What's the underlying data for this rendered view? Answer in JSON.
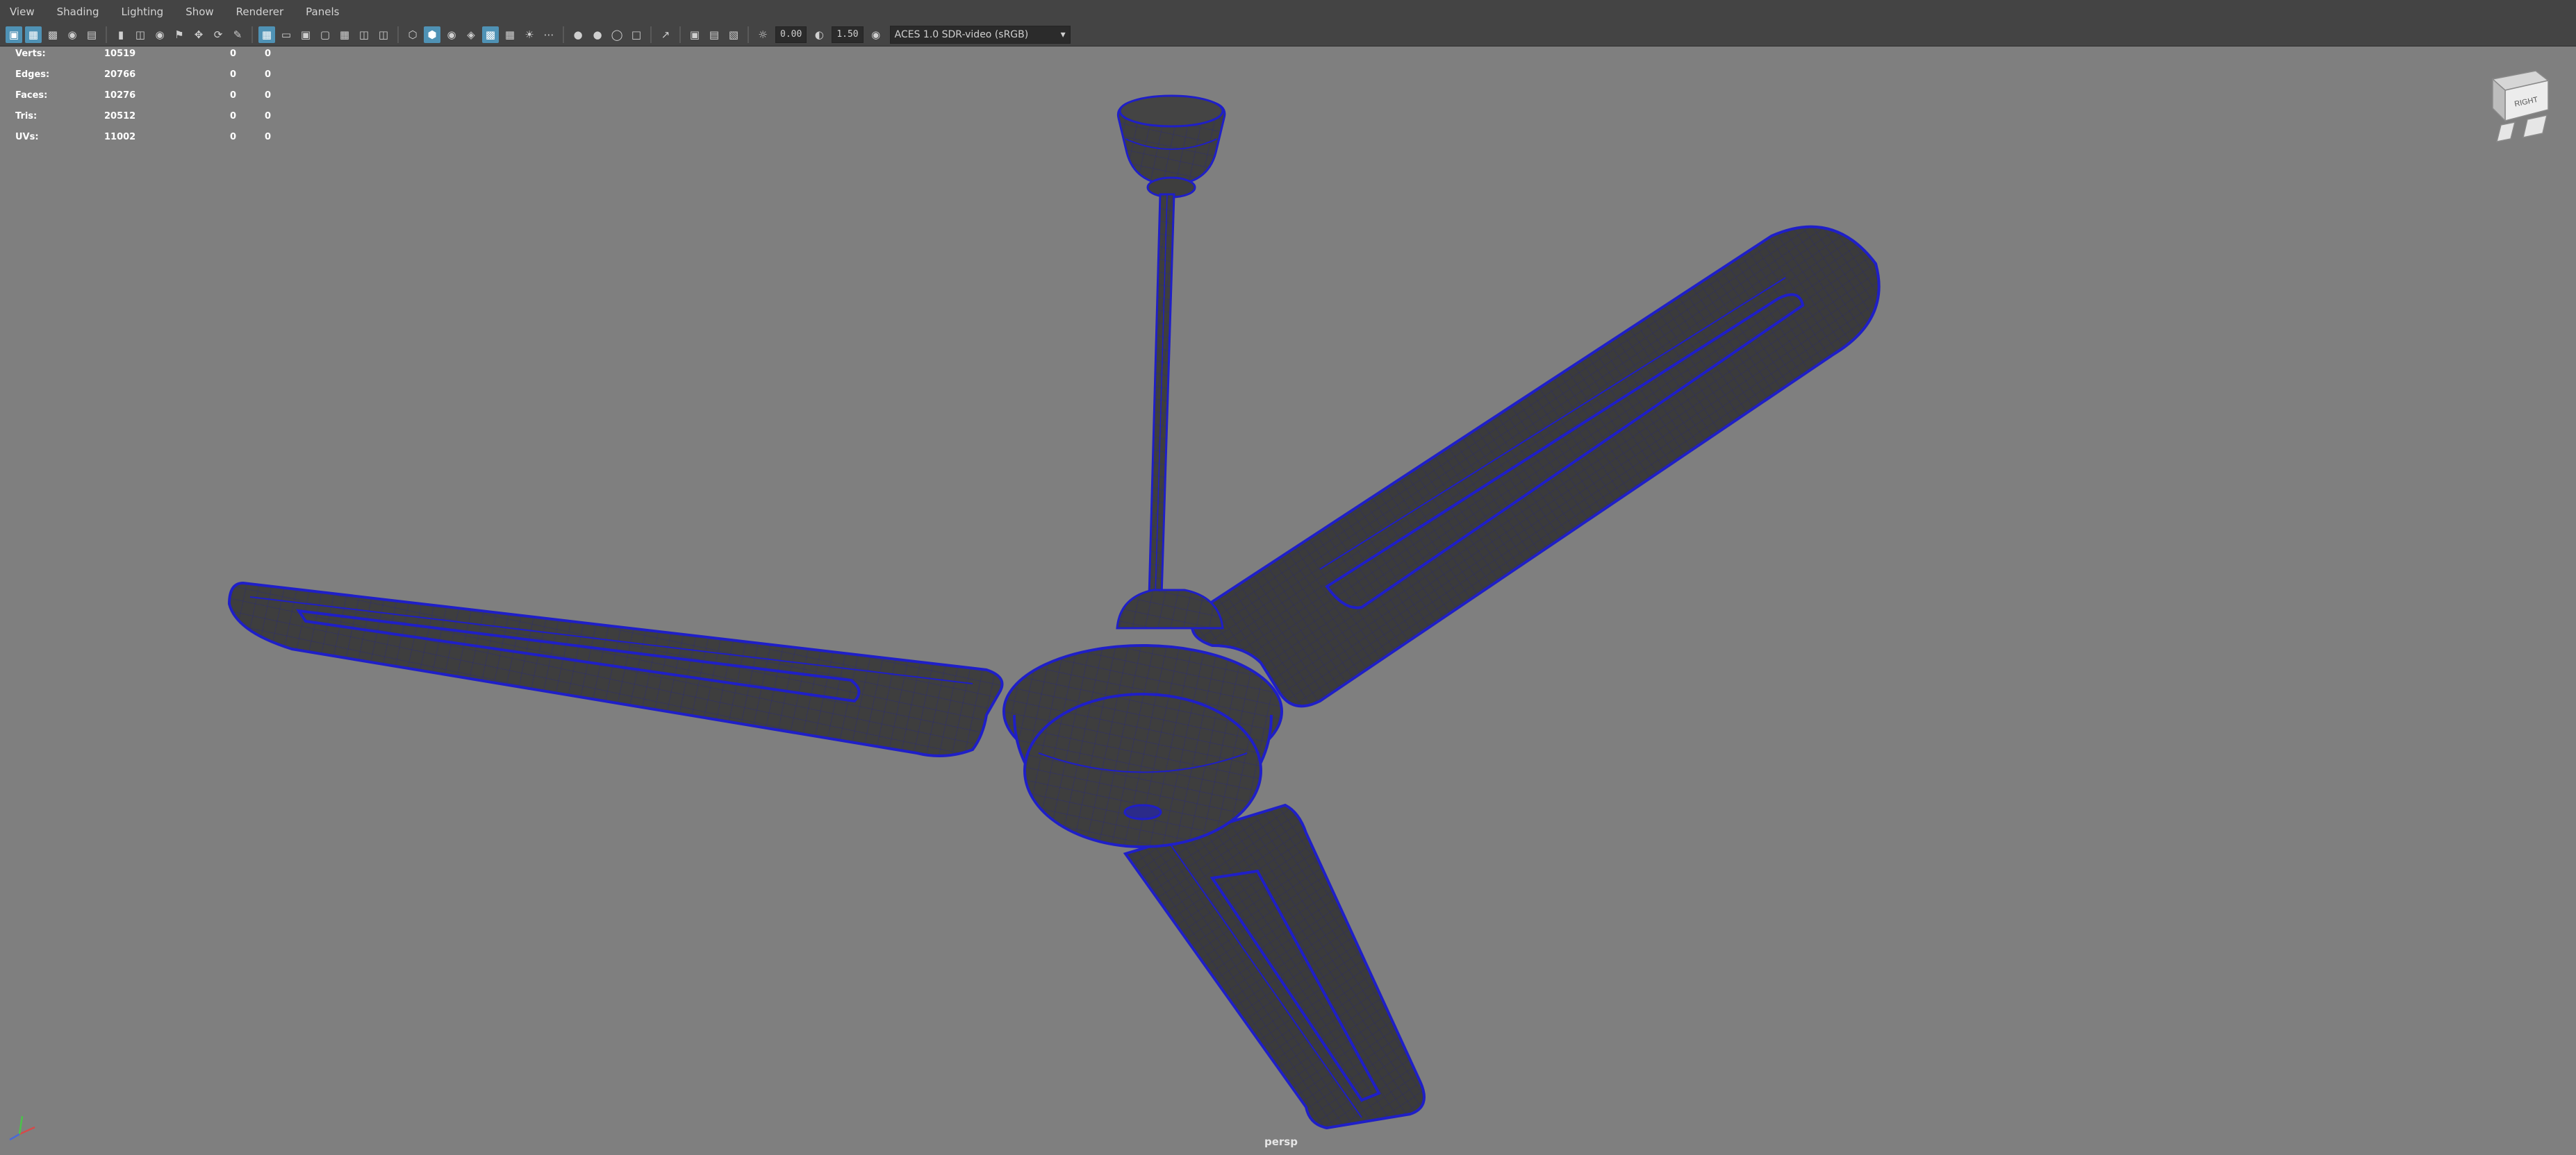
{
  "menubar": {
    "items": [
      {
        "label": "View"
      },
      {
        "label": "Shading"
      },
      {
        "label": "Lighting"
      },
      {
        "label": "Show"
      },
      {
        "label": "Renderer"
      },
      {
        "label": "Panels"
      }
    ]
  },
  "toolbar": {
    "icons_group1": [
      "select-camera-icon",
      "lock-camera-icon",
      "bookmark-icon",
      "image-plane-icon",
      "grid-2d-icon"
    ],
    "icons_group2": [
      "camera-icon",
      "camera-attributes-icon",
      "camera-bookmark-icon",
      "bookmark-flag-icon",
      "track-icon",
      "tumble-icon",
      "zoom-icon"
    ],
    "icons_group3": [
      "grid-icon",
      "film-gate-icon",
      "resolution-gate-icon",
      "gate-mask-icon",
      "field-chart-icon",
      "safe-action-icon"
    ],
    "icons_group4": [
      "wireframe-icon",
      "smooth-shade-icon",
      "default-material-icon",
      "shaded-wireframe-icon",
      "textured-icon",
      "use-all-lights-icon",
      "shadows-icon"
    ],
    "icons_group5": [
      "screen-space-ao-icon",
      "motion-blur-icon",
      "multisample-aa-icon",
      "depth-of-field-icon"
    ],
    "icons_group6": [
      "isolate-select-icon",
      "xray-icon",
      "xray-active-icon",
      "xray-joints-icon"
    ],
    "exposure_value": "0.00",
    "gamma_value": "1.50",
    "colorspace_value": "ACES 1.0 SDR-video (sRGB)"
  },
  "hud": {
    "rows": [
      {
        "label": "Verts:",
        "v1": "10519",
        "v2": "0",
        "v3": "0"
      },
      {
        "label": "Edges:",
        "v1": "20766",
        "v2": "0",
        "v3": "0"
      },
      {
        "label": "Faces:",
        "v1": "10276",
        "v2": "0",
        "v3": "0"
      },
      {
        "label": "Tris:",
        "v1": "20512",
        "v2": "0",
        "v3": "0"
      },
      {
        "label": "UVs:",
        "v1": "11002",
        "v2": "0",
        "v3": "0"
      }
    ]
  },
  "viewport": {
    "camera_label": "persp",
    "background_color": "#7f7f7f",
    "mesh_color": "#3e3e3e",
    "wire_color": "#1f1fc7",
    "viewcube_label": "RIGHT"
  }
}
